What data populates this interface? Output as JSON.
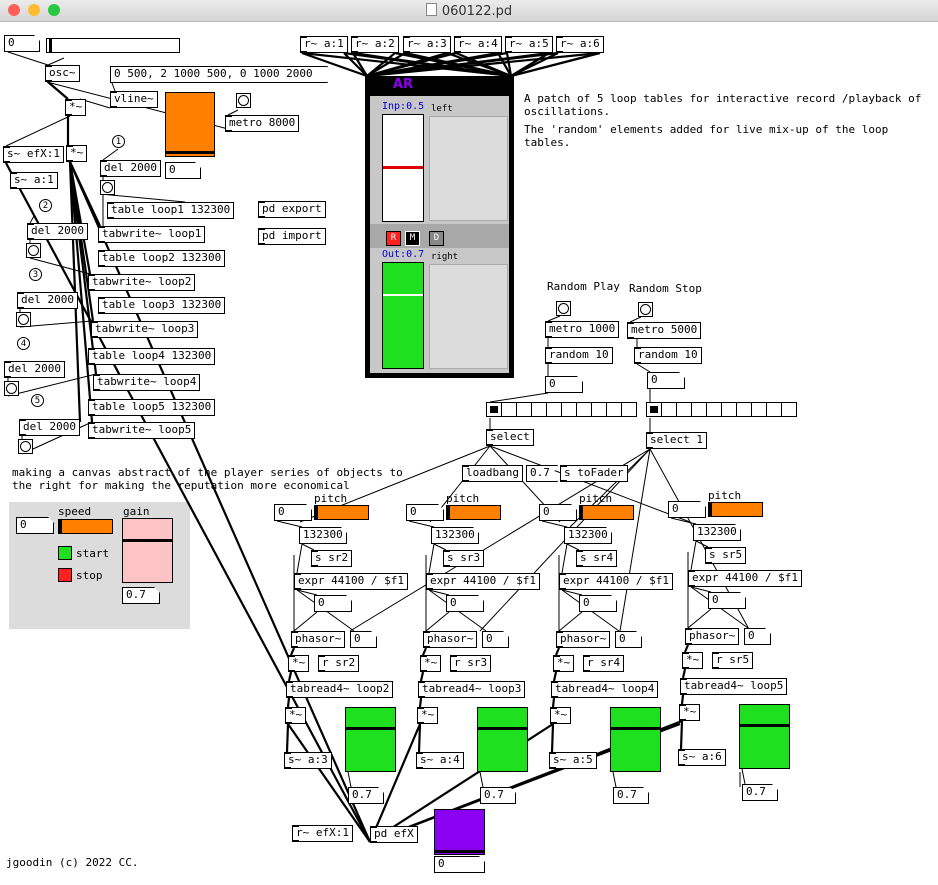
{
  "window": {
    "title": "060122.pd",
    "lights": {
      "close": "#fe5f57",
      "min": "#febc2e",
      "max": "#28c840"
    }
  },
  "colors": {
    "orange": "#ff8000",
    "green": "#1ee01e",
    "purple": "#8a00f0",
    "pink": "#fcc4c4",
    "panel": "#dcdcdc"
  },
  "top": {
    "num0": "0",
    "osc": "osc~",
    "envelope": "0 500, 2 1000 500, 0 1000 2000",
    "vline": "vline~",
    "mul1": "*~",
    "mul2": "*~",
    "metro8000": "metro 8000",
    "efx": "s~ efX:1",
    "sa1": "s~ a:1",
    "del1": "del 2000",
    "dnum": "0",
    "n1": "1",
    "pd_export": "pd export",
    "pd_import": "pd import"
  },
  "loops": [
    {
      "table": "table loop1 132300",
      "write": "tabwrite~ loop1",
      "n": "1",
      "del": "del 2000"
    },
    {
      "table": "table loop2 132300",
      "write": "tabwrite~ loop2",
      "n": "2",
      "del": "del 2000"
    },
    {
      "table": "table loop3 132300",
      "write": "tabwrite~ loop3",
      "n": "3",
      "del": "del 2000"
    },
    {
      "table": "table loop4 132300",
      "write": "tabwrite~ loop4",
      "n": "4",
      "del": "del 2000"
    },
    {
      "table": "table loop5 132300",
      "write": "tabwrite~ loop5",
      "n": "5",
      "del": "del 2000"
    }
  ],
  "receivers": [
    "r~ a:1",
    "r~ a:2",
    "r~ a:3",
    "r~ a:4",
    "r~ a:5",
    "r~ a:6"
  ],
  "ar": {
    "title": "AR",
    "inp": "Inp:0.5",
    "out": "Out:0.7",
    "left": "left",
    "right": "right",
    "r": "R",
    "m": "M",
    "d": "D"
  },
  "comments": {
    "desc1": "A patch of 5 loop tables for interactive record /playback of\noscillations.",
    "desc2": "The 'random' elements added for live mix-up of the loop\ntables.",
    "canvas_note": "making a canvas abstract of the player series of objects to\nthe right for making the reputation more economical",
    "credit": "jgoodin (c) 2022 CC."
  },
  "random": {
    "play": {
      "label": "Random Play",
      "metro": "metro 1000",
      "rnd": "random 10",
      "num": "0",
      "select": "select"
    },
    "stop": {
      "label": "Random Stop",
      "metro": "metro 5000",
      "rnd": "random 10",
      "num": "0",
      "select": "select 1"
    }
  },
  "loadbang": "loadbang",
  "fader_val": "0.7",
  "s_toFader": "s toFader",
  "player": {
    "speed": "speed",
    "gain": "gain",
    "num": "0",
    "start": "start",
    "stop": "stop",
    "gain_val": "0.7",
    "start_color": "#1ee01e",
    "stop_color": "#ff2020"
  },
  "voices": [
    {
      "pitch": "pitch",
      "num": "0",
      "len": "132300",
      "send": "s sr2",
      "expr": "expr 44100 / $f1",
      "exprout": "0",
      "phasor": "phasor~",
      "pnum": "0",
      "mul": "*~",
      "recv": "r sr2",
      "tabread": "tabread4~ loop2",
      "mul2": "*~",
      "out": "s~ a:3",
      "gain": "0.7"
    },
    {
      "pitch": "pitch",
      "num": "0",
      "len": "132300",
      "send": "s sr3",
      "expr": "expr 44100 / $f1",
      "exprout": "0",
      "phasor": "phasor~",
      "pnum": "0",
      "mul": "*~",
      "recv": "r sr3",
      "tabread": "tabread4~ loop3",
      "mul2": "*~",
      "out": "s~ a:4",
      "gain": "0.7"
    },
    {
      "pitch": "pitch",
      "num": "0",
      "len": "132300",
      "send": "s sr4",
      "expr": "expr 44100 / $f1",
      "exprout": "0",
      "phasor": "phasor~",
      "pnum": "0",
      "mul": "*~",
      "recv": "r sr4",
      "tabread": "tabread4~ loop4",
      "mul2": "*~",
      "out": "s~ a:5",
      "gain": "0.7"
    },
    {
      "pitch": "pitch",
      "num": "0",
      "len": "132300",
      "send": "s sr5",
      "expr": "expr 44100 / $f1",
      "exprout": "0",
      "phasor": "phasor~",
      "pnum": "0",
      "mul": "*~",
      "recv": "r sr5",
      "tabread": "tabread4~ loop5",
      "mul2": "*~",
      "out": "s~ a:6",
      "gain": "0.7"
    }
  ],
  "fx": {
    "recv": "r~ efX:1",
    "pd": "pd efX",
    "num": "0"
  }
}
